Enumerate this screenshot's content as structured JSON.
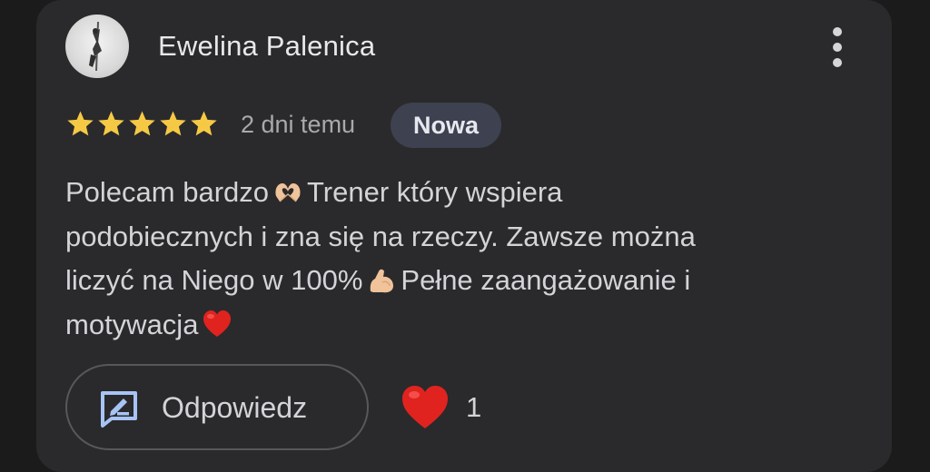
{
  "review": {
    "reviewer_name": "Ewelina Palenica",
    "rating": 5,
    "rating_max": 5,
    "date": "2 dni temu",
    "badge": "Nowa",
    "text_lines": [
      {
        "before": "Polecam bardzo",
        "emoji": "heart-hands",
        "after": "Trener który wspiera"
      },
      {
        "before": "podobiecznych i zna się na rzeczy. Zawsze można"
      },
      {
        "before": "liczyć na Niego w 100%",
        "emoji": "flexed-biceps",
        "after": "Pełne zaangażowanie i"
      },
      {
        "before": "motywacja",
        "emoji": "red-heart"
      }
    ]
  },
  "actions": {
    "reply_label": "Odpowiedz",
    "reaction_emoji": "red-heart",
    "reaction_count": "1"
  },
  "colors": {
    "card_background": "#2a2a2c",
    "star": "#f6c945",
    "badge_background": "#3d4150",
    "reply_icon": "#a8c4f5",
    "heart": "#e0231f"
  },
  "icons": {
    "menu": "more-vertical-icon",
    "reply": "reply-edit-icon",
    "star": "star-icon"
  }
}
